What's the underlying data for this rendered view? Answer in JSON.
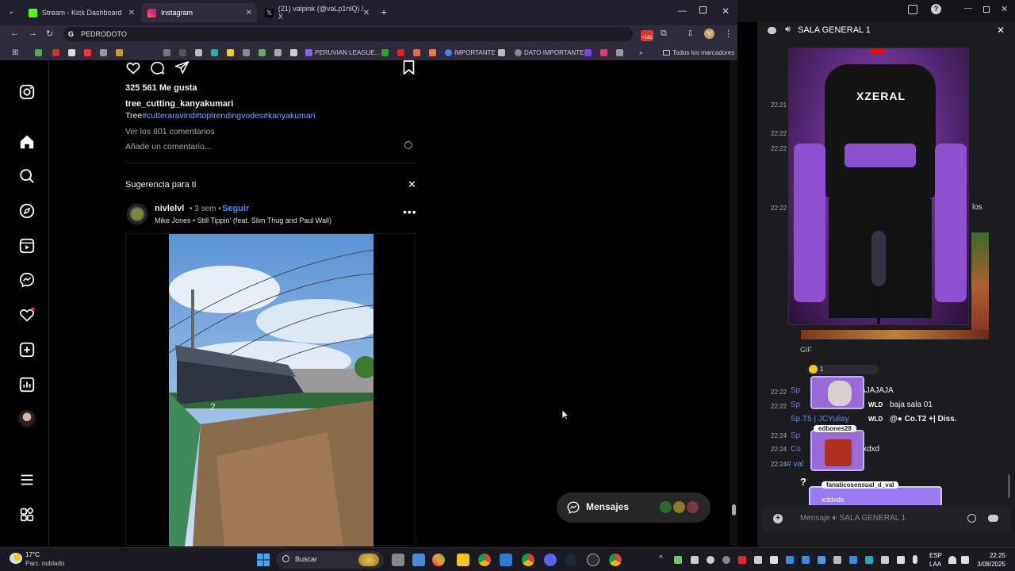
{
  "browser": {
    "tabs": [
      {
        "label": "Stream - Kick Dashboard",
        "color": "#53fc18"
      },
      {
        "label": "Instagram",
        "color": "#e1306c"
      },
      {
        "label": "(21) valpink (@vaLp1nlQ) / X",
        "color": "#ffffff"
      }
    ],
    "new_tab": "+",
    "address": "PEDRODOTO",
    "profile_letter": "V",
    "badge": "+181",
    "bookmarks": [
      {
        "label": "PERUVIAN LEAGUE...",
        "color": "#8b5cf6"
      },
      {
        "label": "IMPORTANTE",
        "color": "#4285f4"
      },
      {
        "label": "DATO IMPORTANTE",
        "color": "#888888"
      }
    ],
    "all_bookmarks": "Todos los marcadores"
  },
  "post": {
    "likes": "325 561 Me gusta",
    "username": "tree_cutting_kanyakumari",
    "caption_word": "Tree",
    "caption_tags": "#cutteraravind#toptrendingvodes#kanyakumari",
    "view_comments": "Ver los 801 comentarios",
    "add_comment": "Añade un comentario..."
  },
  "suggestion": {
    "heading": "Sugerencia para ti",
    "user": "nivlelvl",
    "time": "• 3 sem •",
    "follow": "Seguir",
    "song": "Mike Jones • Still Tippin' (feat. Slim Thug and Paul Wall)",
    "dumpster_number": "2"
  },
  "messages_button": "Mensajes",
  "chat": {
    "title": "SALA GENERAL 1",
    "stream_overlay": "XZERAL",
    "side_word": "los",
    "gif_label": "GIF",
    "times": [
      "22:21",
      "22:22",
      "22:22",
      "22:22",
      "22:22",
      "22:22",
      "22:24",
      "22:24",
      "22:24"
    ],
    "reaction_count": "1",
    "messages": [
      {
        "user": "Sp",
        "text": "AJAJAJA"
      },
      {
        "user": "Sp",
        "text": "baja sala 01"
      },
      {
        "user": "Sp.T5 | JCYuliay",
        "text": "@● Co.T2 +| Diss."
      },
      {
        "user": "Sp",
        "text": ""
      },
      {
        "user": "Co",
        "text": "xdxd"
      },
      {
        "user": "# val",
        "text": ""
      }
    ],
    "wld": "WLD",
    "sticker_name_1": "edbones28",
    "sticker_name_2": "fanaticosensual_d_val",
    "sticker_text_2": "xddxdx",
    "question": "?",
    "input_placeholder": "Mensaje",
    "input_room": "SALA GENERAL 1"
  },
  "taskbar": {
    "weather_temp": "17°C",
    "weather_desc": "Parc. nublado",
    "search": "Buscar",
    "lang": "ESP",
    "lang2": "LAA",
    "time": "22:25",
    "date": "3/08/2025"
  },
  "colors": {
    "link": "#7fa7ff",
    "follow": "#4c8bf5",
    "accent_purple": "#9b59d0"
  }
}
